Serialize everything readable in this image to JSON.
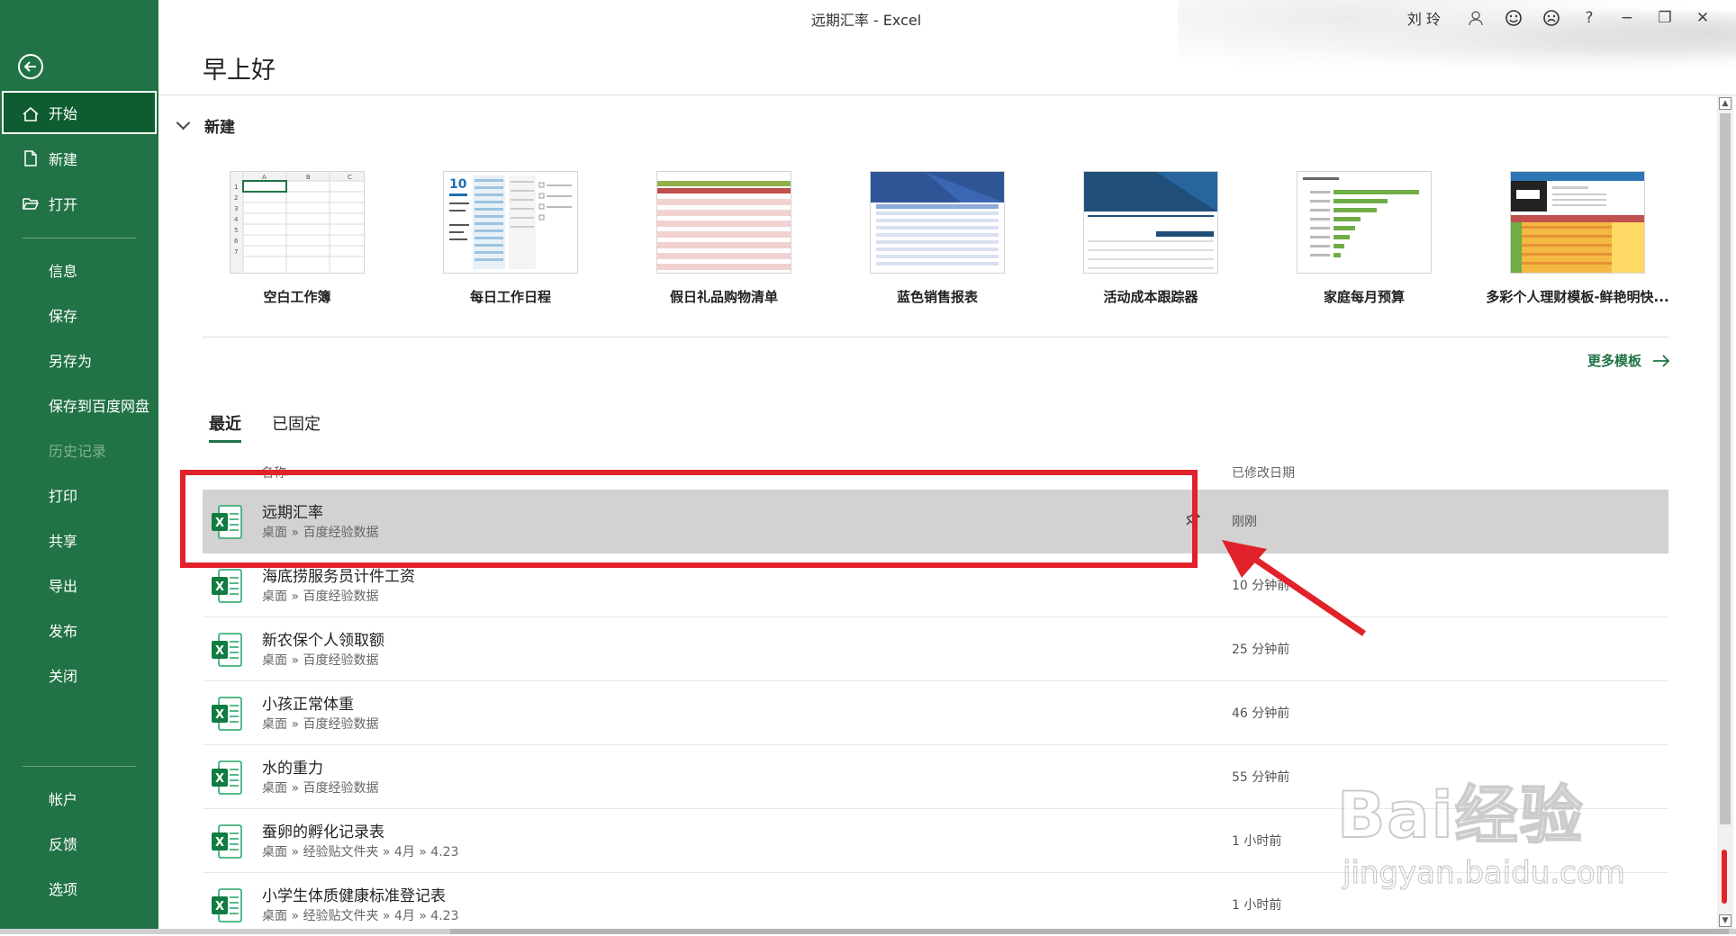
{
  "window": {
    "title": "远期汇率  -  Excel",
    "user": "刘 玲",
    "buttons": {
      "help": "?",
      "minimize": "−",
      "restore": "❐",
      "close": "✕"
    }
  },
  "sidebar": {
    "items": [
      {
        "label": "开始",
        "icon": "home-icon"
      },
      {
        "label": "新建",
        "icon": "new-file-icon"
      },
      {
        "label": "打开",
        "icon": "folder-open-icon"
      },
      {
        "label": "信息"
      },
      {
        "label": "保存"
      },
      {
        "label": "另存为"
      },
      {
        "label": "保存到百度网盘"
      },
      {
        "label": "历史记录"
      },
      {
        "label": "打印"
      },
      {
        "label": "共享"
      },
      {
        "label": "导出"
      },
      {
        "label": "发布"
      },
      {
        "label": "关闭"
      },
      {
        "label": "帐户"
      },
      {
        "label": "反馈"
      },
      {
        "label": "选项"
      }
    ]
  },
  "main": {
    "greeting": "早上好",
    "new_section": "新建",
    "templates": [
      {
        "label": "空白工作簿"
      },
      {
        "label": "每日工作日程"
      },
      {
        "label": "假日礼品购物清单"
      },
      {
        "label": "蓝色销售报表"
      },
      {
        "label": "活动成本跟踪器"
      },
      {
        "label": "家庭每月预算"
      },
      {
        "label": "多彩个人理财模板-鲜艳明快..."
      }
    ],
    "more_templates": "更多模板",
    "tabs": {
      "recent": "最近",
      "pinned": "已固定"
    },
    "columns": {
      "name": "名称",
      "modified": "已修改日期"
    },
    "files": [
      {
        "name": "远期汇率",
        "path": "桌面 » 百度经验数据",
        "date": "刚刚"
      },
      {
        "name": "海底捞服务员计件工资",
        "path": "桌面 » 百度经验数据",
        "date": "10 分钟前"
      },
      {
        "name": "新农保个人领取额",
        "path": "桌面 » 百度经验数据",
        "date": "25 分钟前"
      },
      {
        "name": "小孩正常体重",
        "path": "桌面 » 百度经验数据",
        "date": "46 分钟前"
      },
      {
        "name": "水的重力",
        "path": "桌面 » 百度经验数据",
        "date": "55 分钟前"
      },
      {
        "name": "蚕卵的孵化记录表",
        "path": "桌面 » 经验贴文件夹 » 4月 » 4.23",
        "date": "1 小时前"
      },
      {
        "name": "小学生体质健康标准登记表",
        "path": "桌面 » 经验贴文件夹 » 4月 » 4.23",
        "date": "1 小时前"
      }
    ]
  },
  "watermark": {
    "brand": "Bai经验",
    "site": "jingyan.baidu.com"
  },
  "colors": {
    "accent": "#217346",
    "annotation": "#e1222a"
  }
}
